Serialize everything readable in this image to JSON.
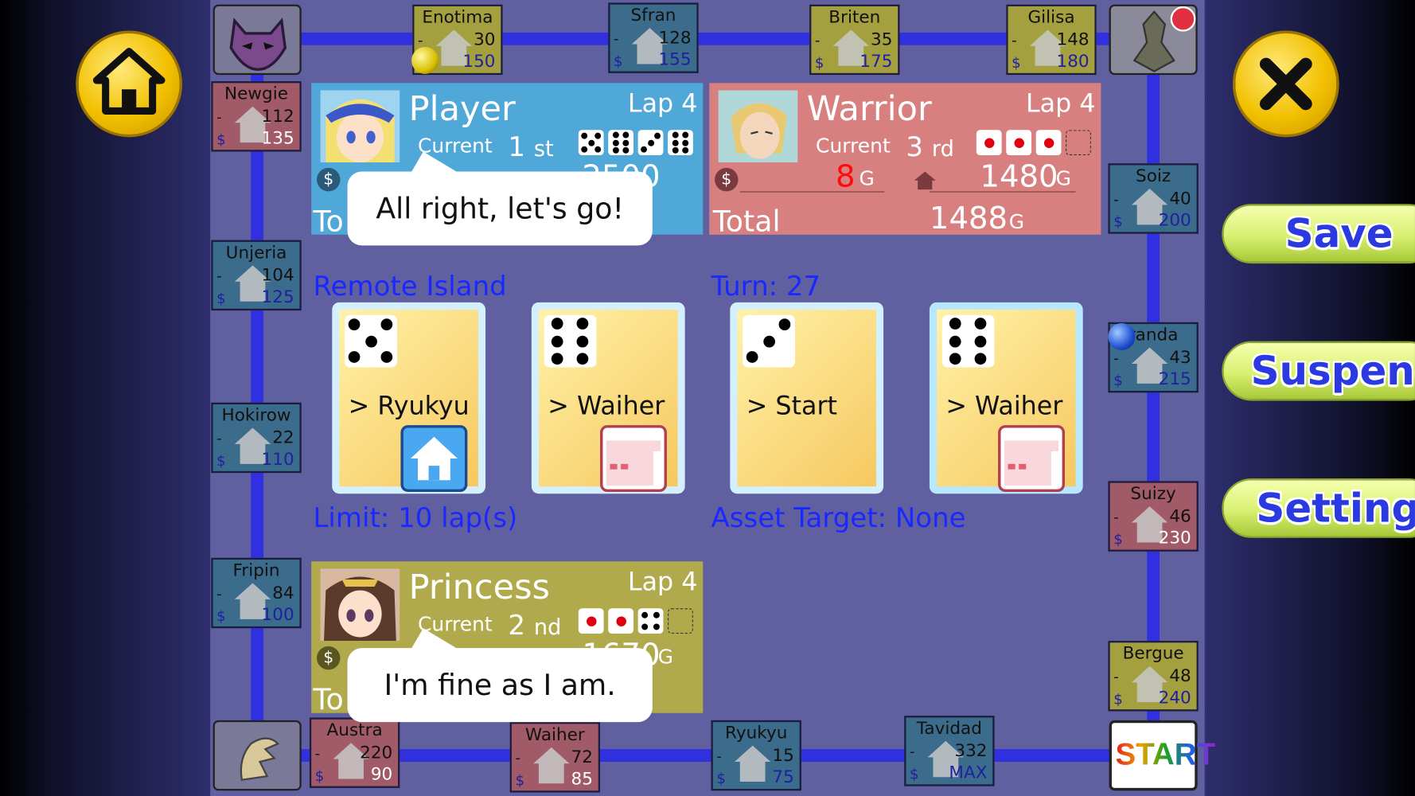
{
  "board": {
    "top": [
      {
        "name": "Enotima",
        "level": "30",
        "price": "150",
        "color": "yel"
      },
      {
        "name": "Sfran",
        "level": "128",
        "price": "155",
        "color": "tea"
      },
      {
        "name": "Briten",
        "level": "35",
        "price": "175",
        "color": "yel"
      },
      {
        "name": "Gilisa",
        "level": "148",
        "price": "180",
        "color": "yel"
      }
    ],
    "left": [
      {
        "name": "Newgie",
        "level": "112",
        "price": "135",
        "color": "red"
      },
      {
        "name": "Unjeria",
        "level": "104",
        "price": "125",
        "color": "tea"
      },
      {
        "name": "Hokirow",
        "level": "22",
        "price": "110",
        "color": "tea"
      },
      {
        "name": "Fripin",
        "level": "84",
        "price": "100",
        "color": "tea"
      }
    ],
    "right": [
      {
        "name": "Soiz",
        "level": "40",
        "price": "200",
        "color": "tea"
      },
      {
        "name": "randa",
        "level": "43",
        "price": "215",
        "color": "tea"
      },
      {
        "name": "Suizy",
        "level": "46",
        "price": "230",
        "color": "red"
      },
      {
        "name": "Bergue",
        "level": "48",
        "price": "240",
        "color": "yel"
      }
    ],
    "bottom": [
      {
        "name": "Austra",
        "level": "220",
        "price": "90",
        "color": "red"
      },
      {
        "name": "Waiher",
        "level": "72",
        "price": "85",
        "color": "red"
      },
      {
        "name": "Ryukyu",
        "level": "15",
        "price": "75",
        "color": "tea"
      },
      {
        "name": "Tavidad",
        "level": "332",
        "price": "MAX",
        "color": "tea"
      }
    ],
    "dash": "-",
    "dollar": "$",
    "start_label": "START"
  },
  "players": {
    "player": {
      "name": "Player",
      "lap": "Lap 4",
      "current_label": "Current",
      "rank_num": "1",
      "rank_suffix": "st",
      "cash": "2500",
      "total_label": "To",
      "speech": "All right, let's go!"
    },
    "warrior": {
      "name": "Warrior",
      "lap": "Lap 4",
      "current_label": "Current",
      "rank_num": "3",
      "rank_suffix": "rd",
      "cash": "8",
      "cash_unit": "G",
      "property": "1480",
      "property_unit": "G",
      "total_label": "Total",
      "total": "1488",
      "total_unit": "G"
    },
    "princess": {
      "name": "Princess",
      "lap": "Lap 4",
      "current_label": "Current",
      "rank_num": "2",
      "rank_suffix": "nd",
      "cash": "1670",
      "cash_unit": "G",
      "total_label": "To",
      "speech": "I'm fine as I am."
    }
  },
  "info": {
    "location": "Remote Island",
    "turn": "Turn: 27",
    "limit": "Limit: 10 lap(s)",
    "asset_target": "Asset Target: None"
  },
  "cards": [
    {
      "dice": 5,
      "destination": "> Ryukyu",
      "badge": "house"
    },
    {
      "dice": 6,
      "destination": "> Waiher",
      "badge": "plot"
    },
    {
      "dice": 3,
      "destination": "> Start",
      "badge": "none"
    },
    {
      "dice": 6,
      "destination": "> Waiher",
      "badge": "plot"
    }
  ],
  "buttons": {
    "save": "Save",
    "suspend": "Suspend",
    "settings": "Settings",
    "home_icon": "home-icon",
    "close_icon": "close-icon"
  },
  "colors": {
    "board": "#6060a0",
    "track": "#3030e0",
    "player_panel": "#4fa8d8",
    "warrior_panel": "#d88080",
    "princess_panel": "#b0aa4c",
    "info_text": "#1a28ff",
    "menu_text": "#2a3ae0"
  }
}
